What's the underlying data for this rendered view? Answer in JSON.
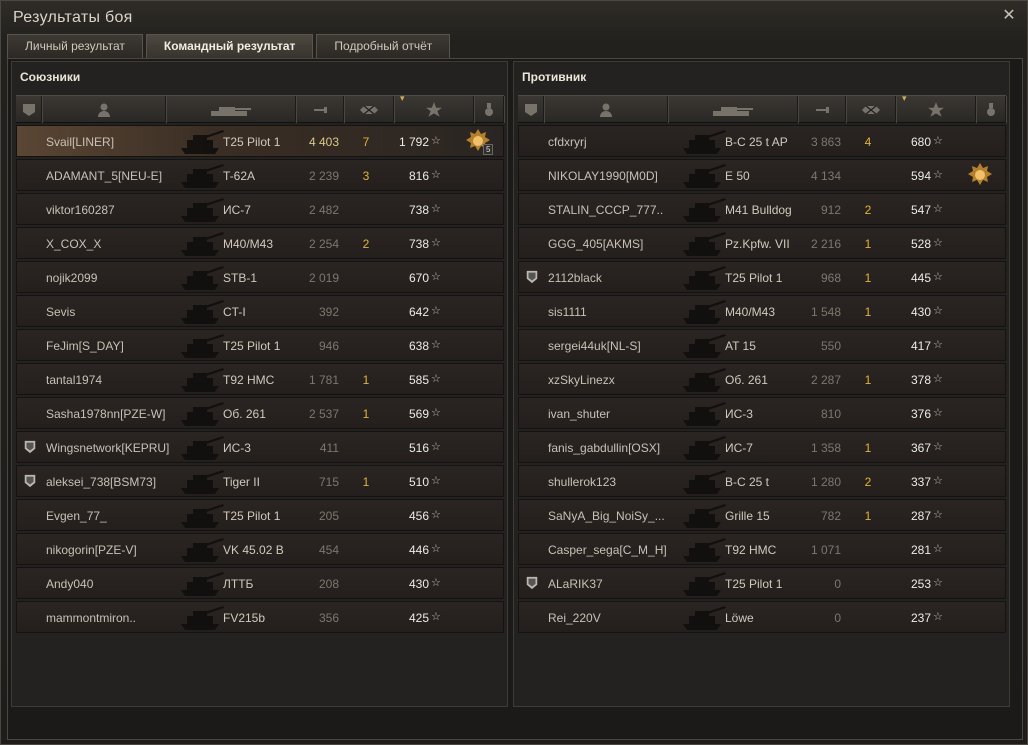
{
  "window": {
    "title": "Результаты боя"
  },
  "tabs": [
    {
      "label": "Личный результат"
    },
    {
      "label": "Командный результат"
    },
    {
      "label": "Подробный отчёт"
    }
  ],
  "columns": [
    "clan-icon",
    "player-icon",
    "tank-icon",
    "damage-icon",
    "kills-icon",
    "xp-sort-icon",
    "medal-icon"
  ],
  "allies": {
    "title": "Союзники",
    "rows": [
      {
        "name": "Svail[LINER]",
        "vehicle": "T25 Pilot 1",
        "damage": "4 403",
        "kills": "7",
        "xp": "1 792",
        "medal": true,
        "medal_count": "5",
        "me": true,
        "clan": false
      },
      {
        "name": "ADAMANT_5[NEU-E]",
        "vehicle": "T-62A",
        "damage": "2 239",
        "kills": "3",
        "xp": "816",
        "clan": false
      },
      {
        "name": "viktor160287",
        "vehicle": "ИС-7",
        "damage": "2 482",
        "kills": "",
        "xp": "738",
        "clan": false
      },
      {
        "name": "X_COX_X",
        "vehicle": "M40/M43",
        "damage": "2 254",
        "kills": "2",
        "xp": "738",
        "clan": false
      },
      {
        "name": "nojik2099",
        "vehicle": "STB-1",
        "damage": "2 019",
        "kills": "",
        "xp": "670",
        "clan": false
      },
      {
        "name": "Sevis",
        "vehicle": "CT-I",
        "damage": "392",
        "kills": "",
        "xp": "642",
        "clan": false
      },
      {
        "name": "FeJim[S_DAY]",
        "vehicle": "T25 Pilot 1",
        "damage": "946",
        "kills": "",
        "xp": "638",
        "clan": false
      },
      {
        "name": "tantal1974",
        "vehicle": "T92 HMC",
        "damage": "1 781",
        "kills": "1",
        "xp": "585",
        "clan": false
      },
      {
        "name": "Sasha1978nn[PZE-W]",
        "vehicle": "Об. 261",
        "damage": "2 537",
        "kills": "1",
        "xp": "569",
        "clan": false
      },
      {
        "name": "Wingsnetwork[KEPRU]",
        "vehicle": "ИС-3",
        "damage": "411",
        "kills": "",
        "xp": "516",
        "clan": true
      },
      {
        "name": "aleksei_738[BSM73]",
        "vehicle": "Tiger II",
        "damage": "715",
        "kills": "1",
        "xp": "510",
        "clan": true
      },
      {
        "name": "Evgen_77_",
        "vehicle": "T25 Pilot 1",
        "damage": "205",
        "kills": "",
        "xp": "456",
        "clan": false
      },
      {
        "name": "nikogorin[PZE-V]",
        "vehicle": "VK 45.02 B",
        "damage": "454",
        "kills": "",
        "xp": "446",
        "clan": false
      },
      {
        "name": "Andy040",
        "vehicle": "ЛТТБ",
        "damage": "208",
        "kills": "",
        "xp": "430",
        "clan": false
      },
      {
        "name": "mammontmiron..",
        "vehicle": "FV215b",
        "damage": "356",
        "kills": "",
        "xp": "425",
        "clan": false
      }
    ]
  },
  "enemies": {
    "title": "Противник",
    "rows": [
      {
        "name": "cfdxryrj",
        "vehicle": "B-C 25 t AP",
        "damage": "3 863",
        "kills": "4",
        "xp": "680",
        "clan": false
      },
      {
        "name": "NIKOLAY1990[M0D]",
        "vehicle": "E 50",
        "damage": "4 134",
        "kills": "",
        "xp": "594",
        "medal": true,
        "clan": false
      },
      {
        "name": "STALIN_CCCP_777..",
        "vehicle": "M41 Bulldog",
        "damage": "912",
        "kills": "2",
        "xp": "547",
        "clan": false
      },
      {
        "name": "GGG_405[AKMS]",
        "vehicle": "Pz.Kpfw. VII",
        "damage": "2 216",
        "kills": "1",
        "xp": "528",
        "clan": false
      },
      {
        "name": "2112black",
        "vehicle": "T25 Pilot 1",
        "damage": "968",
        "kills": "1",
        "xp": "445",
        "clan": true
      },
      {
        "name": "sis1111",
        "vehicle": "M40/M43",
        "damage": "1 548",
        "kills": "1",
        "xp": "430",
        "clan": false
      },
      {
        "name": "sergei44uk[NL-S]",
        "vehicle": "AT 15",
        "damage": "550",
        "kills": "",
        "xp": "417",
        "clan": false
      },
      {
        "name": "xzSkyLinezx",
        "vehicle": "Об. 261",
        "damage": "2 287",
        "kills": "1",
        "xp": "378",
        "clan": false
      },
      {
        "name": "ivan_shuter",
        "vehicle": "ИС-3",
        "damage": "810",
        "kills": "",
        "xp": "376",
        "clan": false
      },
      {
        "name": "fanis_gabdullin[OSX]",
        "vehicle": "ИС-7",
        "damage": "1 358",
        "kills": "1",
        "xp": "367",
        "clan": false
      },
      {
        "name": "shullerok123",
        "vehicle": "B-C 25 t",
        "damage": "1 280",
        "kills": "2",
        "xp": "337",
        "clan": false
      },
      {
        "name": "SaNyA_Big_NoiSy_...",
        "vehicle": "Grille 15",
        "damage": "782",
        "kills": "1",
        "xp": "287",
        "clan": false
      },
      {
        "name": "Casper_sega[C_M_H]",
        "vehicle": "T92 HMC",
        "damage": "1 071",
        "kills": "",
        "xp": "281",
        "clan": false
      },
      {
        "name": "ALaRIK37",
        "vehicle": "T25 Pilot 1",
        "damage": "0",
        "kills": "",
        "xp": "253",
        "clan": true
      },
      {
        "name": "Rei_220V",
        "vehicle": "Löwe",
        "damage": "0",
        "kills": "",
        "xp": "237",
        "clan": false
      }
    ]
  },
  "star_glyph": "☆"
}
